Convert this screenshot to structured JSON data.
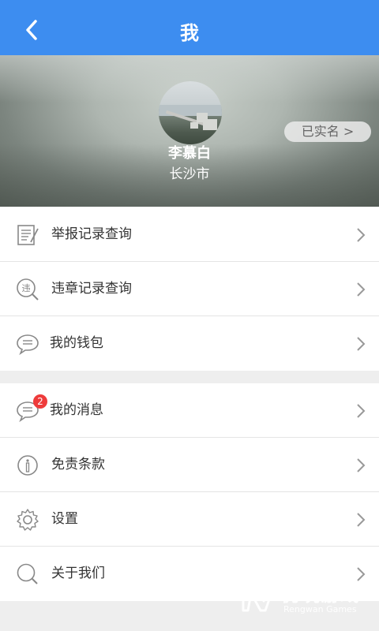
{
  "header": {
    "title": "我",
    "back_icon": "chevron-left-icon"
  },
  "profile": {
    "name": "李慕白",
    "city": "长沙市",
    "verified_label": "已实名 >"
  },
  "menu_group_1": [
    {
      "label": "举报记录查询",
      "icon": "report-list-icon"
    },
    {
      "label": "违章记录查询",
      "icon": "violation-search-icon"
    },
    {
      "label": "我的钱包",
      "icon": "chat-bubble-icon"
    }
  ],
  "menu_group_2": [
    {
      "label": "我的消息",
      "icon": "message-icon",
      "badge": "2"
    },
    {
      "label": "免责条款",
      "icon": "info-icon"
    },
    {
      "label": "设置",
      "icon": "gear-icon"
    },
    {
      "label": "关于我们",
      "icon": "search-icon"
    }
  ],
  "watermark": {
    "text": "仍玩游戏",
    "sub": "Rengwan Games"
  },
  "colors": {
    "header": "#3d8df0",
    "badge": "#ee3b3b"
  }
}
